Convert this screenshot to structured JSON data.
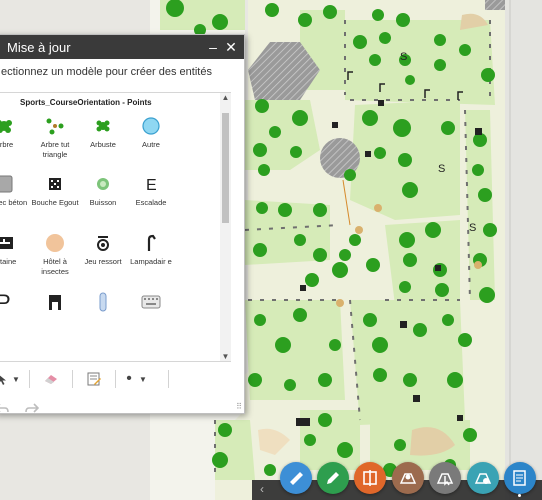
{
  "panel": {
    "title": "Mise à jour",
    "minimize_label": "–",
    "close_label": "✕",
    "instruction": "ectionnez un modèle pour créer des entités",
    "layer_name": "Sports_CourseOrientation - Points",
    "templates": [
      {
        "label": "Arbre",
        "icon": "tree-icon"
      },
      {
        "label": "Arbre tut triangle",
        "icon": "tree-triangle-icon"
      },
      {
        "label": "Arbuste",
        "icon": "shrub-icon"
      },
      {
        "label": "Autre",
        "icon": "circle-blue-icon"
      },
      {
        "label": "loc élec béton",
        "icon": "grey-square-icon"
      },
      {
        "label": "Bouche Egout",
        "icon": "sewer-icon"
      },
      {
        "label": "Buisson",
        "icon": "bush-icon"
      },
      {
        "label": "Escalade",
        "icon": "letter-e-icon"
      },
      {
        "label": "ontaine",
        "icon": "fountain-icon"
      },
      {
        "label": "Hôtel à insectes",
        "icon": "insect-hotel-icon"
      },
      {
        "label": "Jeu ressort",
        "icon": "spring-game-icon"
      },
      {
        "label": "Lampadair e",
        "icon": "streetlamp-icon"
      },
      {
        "label": "",
        "icon": "parking-p-icon"
      },
      {
        "label": "",
        "icon": "bench-icon"
      },
      {
        "label": "",
        "icon": "pillar-icon"
      },
      {
        "label": "",
        "icon": "keyboard-icon"
      }
    ],
    "toolbar": {
      "pointer_icon": "pointer-icon",
      "eraser_icon": "eraser-icon",
      "attributes_icon": "attributes-icon",
      "point_icon": "point-draw-icon"
    },
    "undo_icon": "undo-icon",
    "redo_icon": "redo-icon"
  },
  "dock": {
    "buttons": [
      {
        "name": "measure-widget-button",
        "color": "#3d8fd6",
        "icon": "ruler-icon"
      },
      {
        "name": "draw-widget-button",
        "color": "#2e9e4e",
        "icon": "pencil-icon"
      },
      {
        "name": "compare-widget-button",
        "color": "#e0672a",
        "icon": "swipe-icon"
      },
      {
        "name": "bookmark-widget-button",
        "color": "#9c6b4e",
        "icon": "map-pin-icon"
      },
      {
        "name": "select-widget-button",
        "color": "#7a7a7a",
        "icon": "select-icon"
      },
      {
        "name": "edit-widget-button",
        "color": "#3aa3b4",
        "icon": "edit-map-icon"
      },
      {
        "name": "edit-panel-button",
        "color": "#2c85c9",
        "icon": "edit-form-icon"
      }
    ]
  }
}
